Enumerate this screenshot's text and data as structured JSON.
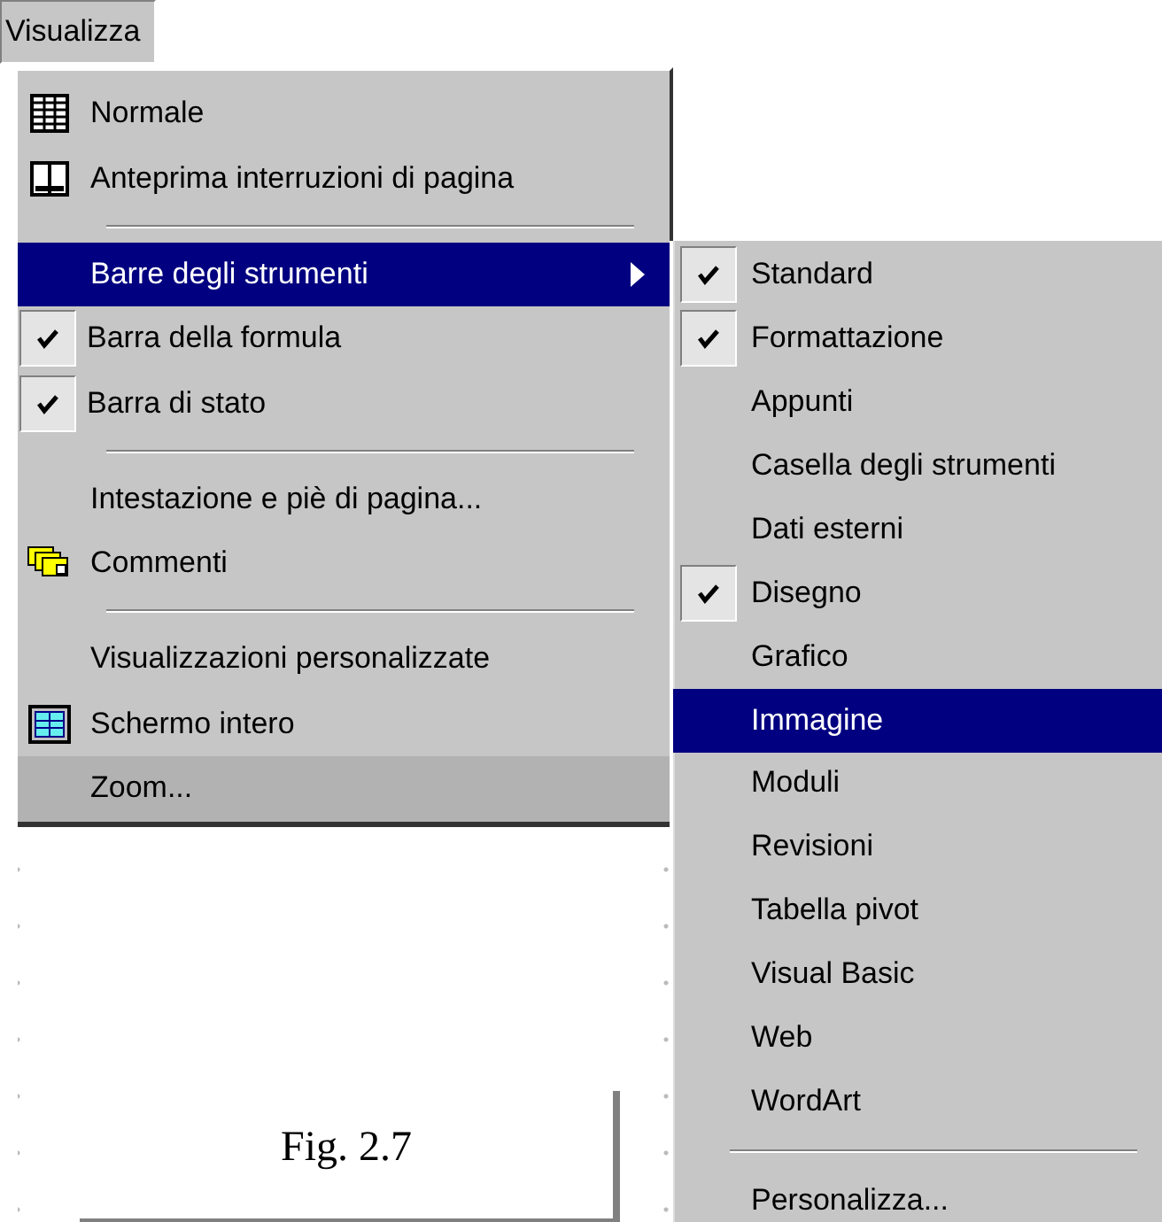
{
  "menu_bar": [
    {
      "label": "Visualizza",
      "selected": true
    }
  ],
  "menu": {
    "items": [
      {
        "kind": "table",
        "label": "Normale",
        "checked": false,
        "selected": false,
        "has_submenu": false,
        "recessed": false
      },
      {
        "kind": "pages",
        "label": "Anteprima interruzioni di pagina",
        "checked": false,
        "selected": false,
        "has_submenu": false,
        "recessed": false
      },
      {
        "kind": "separator"
      },
      {
        "kind": "item",
        "label": "Barre degli strumenti",
        "checked": false,
        "selected": true,
        "has_submenu": true,
        "recessed": false
      },
      {
        "kind": "item",
        "label": "Barra della formula",
        "checked": true,
        "selected": false,
        "has_submenu": false,
        "recessed": false
      },
      {
        "kind": "item",
        "label": "Barra di stato",
        "checked": true,
        "selected": false,
        "has_submenu": false,
        "recessed": false
      },
      {
        "kind": "separator"
      },
      {
        "kind": "item",
        "label": "Intestazione e piè di pagina...",
        "checked": false,
        "selected": false,
        "has_submenu": false,
        "recessed": false
      },
      {
        "kind": "notes",
        "label": "Commenti",
        "checked": false,
        "selected": false,
        "has_submenu": false,
        "recessed": false
      },
      {
        "kind": "separator"
      },
      {
        "kind": "item",
        "label": "Visualizzazioni personalizzate",
        "checked": false,
        "selected": false,
        "has_submenu": false,
        "recessed": false
      },
      {
        "kind": "screen",
        "label": "Schermo intero",
        "checked": false,
        "selected": false,
        "has_submenu": false,
        "recessed": false
      },
      {
        "kind": "item",
        "label": "Zoom...",
        "checked": false,
        "selected": false,
        "has_submenu": false,
        "recessed": true
      }
    ]
  },
  "submenu": {
    "items": [
      {
        "kind": "item",
        "label": "Standard",
        "checked": true,
        "selected": false
      },
      {
        "kind": "item",
        "label": "Formattazione",
        "checked": true,
        "selected": false
      },
      {
        "kind": "item",
        "label": "Appunti",
        "checked": false,
        "selected": false
      },
      {
        "kind": "item",
        "label": "Casella degli strumenti",
        "checked": false,
        "selected": false
      },
      {
        "kind": "item",
        "label": "Dati esterni",
        "checked": false,
        "selected": false
      },
      {
        "kind": "item",
        "label": "Disegno",
        "checked": true,
        "selected": false
      },
      {
        "kind": "item",
        "label": "Grafico",
        "checked": false,
        "selected": false
      },
      {
        "kind": "item",
        "label": "Immagine",
        "checked": false,
        "selected": true
      },
      {
        "kind": "item",
        "label": "Moduli",
        "checked": false,
        "selected": false
      },
      {
        "kind": "item",
        "label": "Revisioni",
        "checked": false,
        "selected": false
      },
      {
        "kind": "item",
        "label": "Tabella pivot",
        "checked": false,
        "selected": false
      },
      {
        "kind": "item",
        "label": "Visual Basic",
        "checked": false,
        "selected": false
      },
      {
        "kind": "item",
        "label": "Web",
        "checked": false,
        "selected": false
      },
      {
        "kind": "item",
        "label": "WordArt",
        "checked": false,
        "selected": false
      },
      {
        "kind": "separator"
      },
      {
        "kind": "item",
        "label": "Personalizza...",
        "checked": false,
        "selected": false
      }
    ]
  },
  "caption": "Fig. 2.7"
}
